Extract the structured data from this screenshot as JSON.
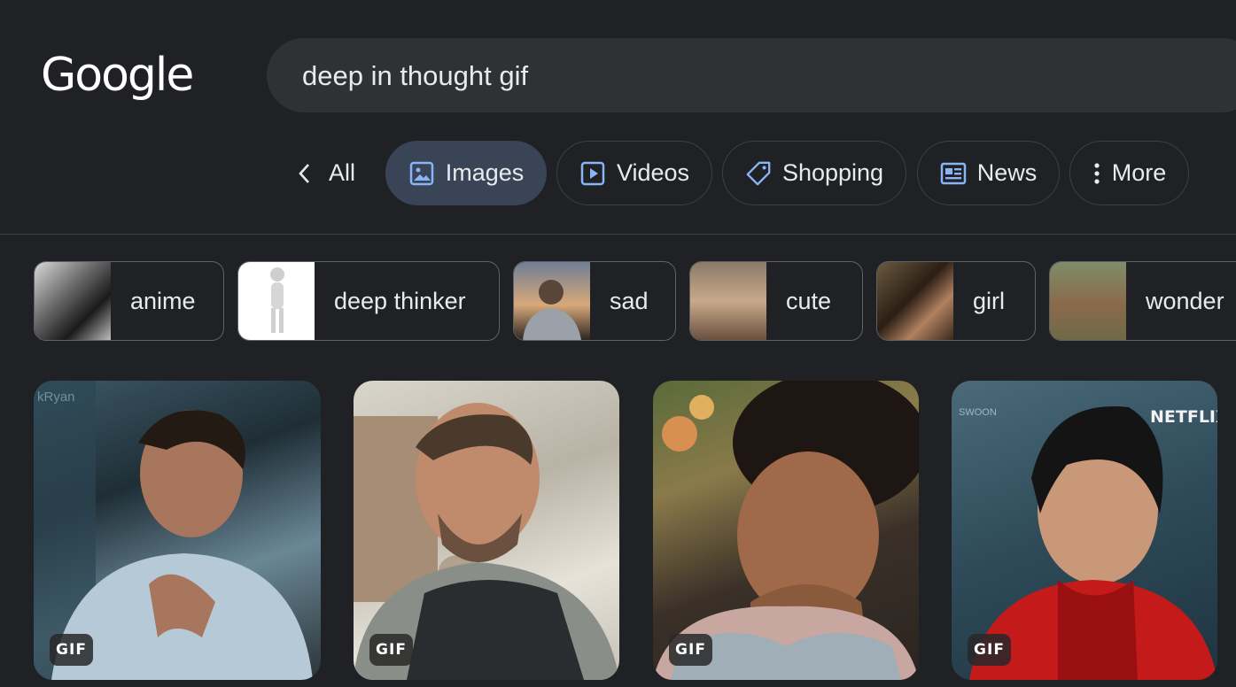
{
  "logo": "Google",
  "search": {
    "query": "deep in thought gif"
  },
  "tabs": [
    {
      "label": "All",
      "icon": "chevron-left-icon"
    },
    {
      "label": "Images",
      "icon": "image-icon",
      "active": true
    },
    {
      "label": "Videos",
      "icon": "play-icon"
    },
    {
      "label": "Shopping",
      "icon": "tag-icon"
    },
    {
      "label": "News",
      "icon": "newspaper-icon"
    },
    {
      "label": "More",
      "icon": "more-vert-icon"
    }
  ],
  "chips": [
    {
      "label": "anime"
    },
    {
      "label": "deep thinker"
    },
    {
      "label": "sad"
    },
    {
      "label": "cute"
    },
    {
      "label": "girl"
    },
    {
      "label": "wonder"
    }
  ],
  "results": [
    {
      "badge": "GIF",
      "watermark": "kRyan"
    },
    {
      "badge": "GIF"
    },
    {
      "badge": "GIF"
    },
    {
      "badge": "GIF",
      "watermark": "NETFLIX",
      "watermark2": "SWOON"
    }
  ],
  "colors": {
    "background": "#202124",
    "search_bg": "#303134",
    "active_tab": "#394457",
    "accent_icon": "#8ab4f8"
  }
}
